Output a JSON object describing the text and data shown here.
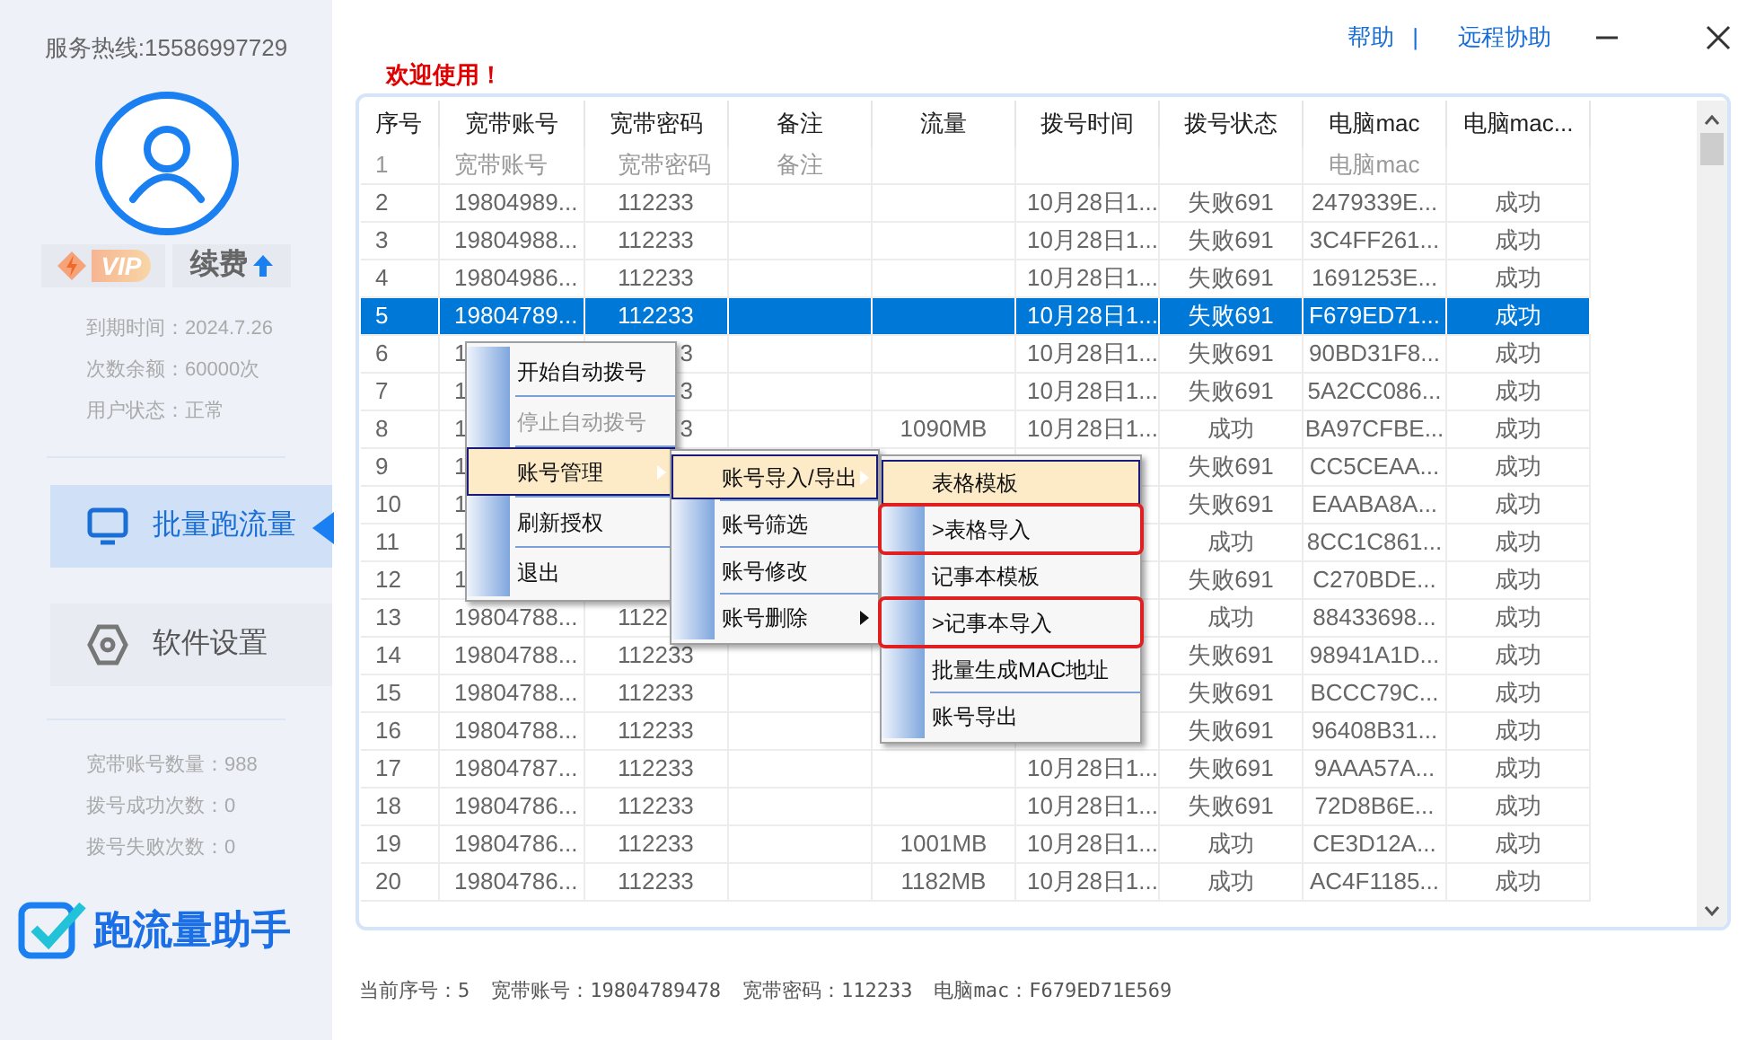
{
  "sidebar": {
    "hotline": "服务热线:15586997729",
    "vip_badge": "VIP",
    "renew_button": "续费",
    "info": [
      "到期时间：2024.7.26",
      "次数余额：60000次",
      "用户状态：正常"
    ],
    "nav": [
      {
        "label": "批量跑流量",
        "selected": true
      },
      {
        "label": "软件设置",
        "selected": false
      }
    ],
    "stats": [
      "宽带账号数量：988",
      "拨号成功次数：0",
      "拨号失败次数：0"
    ],
    "logo": "跑流量助手"
  },
  "header": {
    "links": [
      "帮助",
      "远程协助"
    ],
    "separator": "|",
    "welcome": "欢迎使用！"
  },
  "table": {
    "columns": [
      "序号",
      "宽带账号",
      "宽带密码",
      "备注",
      "流量",
      "拨号时间",
      "拨号状态",
      "电脑mac",
      "电脑mac..."
    ],
    "rows": [
      {
        "kind": "placeholder",
        "selected": false,
        "cells": [
          "1",
          "宽带账号",
          "宽带密码",
          "备注",
          null,
          null,
          null,
          "电脑mac",
          null
        ]
      },
      {
        "kind": "data",
        "selected": false,
        "cells": [
          "2",
          "19804989...",
          "112233",
          null,
          null,
          "10月28日1...",
          "失败691",
          "2479339E...",
          "成功"
        ]
      },
      {
        "kind": "data",
        "selected": false,
        "cells": [
          "3",
          "19804988...",
          "112233",
          null,
          null,
          "10月28日1...",
          "失败691",
          "3C4FF261...",
          "成功"
        ]
      },
      {
        "kind": "data",
        "selected": false,
        "cells": [
          "4",
          "19804986...",
          "112233",
          null,
          null,
          "10月28日1...",
          "失败691",
          "1691253E...",
          "成功"
        ]
      },
      {
        "kind": "data",
        "selected": true,
        "cells": [
          "5",
          "19804789...",
          "112233",
          null,
          null,
          "10月28日1...",
          "失败691",
          "F679ED71...",
          "成功"
        ]
      },
      {
        "kind": "data",
        "selected": false,
        "cells": [
          "6",
          "1",
          {
            "text": "3",
            "clipped_start": true
          },
          null,
          null,
          "10月28日1...",
          "失败691",
          "90BD31F8...",
          "成功"
        ]
      },
      {
        "kind": "data",
        "selected": false,
        "cells": [
          "7",
          "1",
          {
            "text": "3",
            "clipped_start": true
          },
          null,
          null,
          "10月28日1...",
          "失败691",
          "5A2CC086...",
          "成功"
        ]
      },
      {
        "kind": "data",
        "selected": false,
        "cells": [
          "8",
          "1",
          {
            "text": "3",
            "clipped_start": true
          },
          null,
          "1090MB",
          "10月28日1...",
          "成功",
          "BA97CFBE...",
          "成功"
        ]
      },
      {
        "kind": "data",
        "selected": false,
        "cells": [
          "9",
          "1",
          null,
          null,
          null,
          null,
          "失败691",
          "CC5CEAA...",
          "成功"
        ]
      },
      {
        "kind": "data",
        "selected": false,
        "cells": [
          "10",
          "1",
          null,
          null,
          null,
          null,
          "失败691",
          "EAABA8A...",
          "成功"
        ]
      },
      {
        "kind": "data",
        "selected": false,
        "cells": [
          "11",
          "1",
          null,
          null,
          null,
          null,
          "成功",
          "8CC1C861...",
          "成功"
        ]
      },
      {
        "kind": "data",
        "selected": false,
        "cells": [
          "12",
          "1",
          null,
          null,
          null,
          null,
          "失败691",
          "C270BDE...",
          "成功"
        ]
      },
      {
        "kind": "data",
        "selected": false,
        "cells": [
          "13",
          "19804788...",
          "1122",
          null,
          null,
          null,
          "成功",
          "88433698...",
          "成功"
        ]
      },
      {
        "kind": "data",
        "selected": false,
        "cells": [
          "14",
          "19804788...",
          "112233",
          null,
          null,
          null,
          "失败691",
          "98941A1D...",
          "成功"
        ]
      },
      {
        "kind": "data",
        "selected": false,
        "cells": [
          "15",
          "19804788...",
          "112233",
          null,
          null,
          null,
          "失败691",
          "BCCC79C...",
          "成功"
        ]
      },
      {
        "kind": "data",
        "selected": false,
        "cells": [
          "16",
          "19804788...",
          "112233",
          null,
          null,
          null,
          "失败691",
          "96408B31...",
          "成功"
        ]
      },
      {
        "kind": "data",
        "selected": false,
        "cells": [
          "17",
          "19804787...",
          "112233",
          null,
          null,
          "10月28日1...",
          "失败691",
          "9AAA57A...",
          "成功"
        ]
      },
      {
        "kind": "data",
        "selected": false,
        "cells": [
          "18",
          "19804786...",
          "112233",
          null,
          null,
          "10月28日1...",
          "失败691",
          "72D8B6E...",
          "成功"
        ]
      },
      {
        "kind": "data",
        "selected": false,
        "cells": [
          "19",
          "19804786...",
          "112233",
          null,
          "1001MB",
          "10月28日1...",
          "成功",
          "CE3D12A...",
          "成功"
        ]
      },
      {
        "kind": "data",
        "selected": false,
        "cells": [
          "20",
          "19804786...",
          "112233",
          null,
          "1182MB",
          "10月28日1...",
          "成功",
          "AC4F1185...",
          "成功"
        ]
      }
    ]
  },
  "menus": [
    {
      "items": [
        {
          "label": "开始自动拨号",
          "disabled": false,
          "selected": false,
          "submenu": false,
          "marked": false
        },
        {
          "label": "停止自动拨号",
          "disabled": true,
          "selected": false,
          "submenu": false,
          "marked": false
        },
        {
          "label": "账号管理",
          "disabled": false,
          "selected": true,
          "submenu": true,
          "marked": false
        },
        {
          "label": "刷新授权",
          "disabled": false,
          "selected": false,
          "submenu": false,
          "marked": false
        },
        {
          "label": "退出",
          "disabled": false,
          "selected": false,
          "submenu": false,
          "marked": false
        }
      ]
    },
    {
      "items": [
        {
          "label": "账号导入/导出",
          "disabled": false,
          "selected": true,
          "submenu": true,
          "marked": false
        },
        {
          "label": "账号筛选",
          "disabled": false,
          "selected": false,
          "submenu": false,
          "marked": false
        },
        {
          "label": "账号修改",
          "disabled": false,
          "selected": false,
          "submenu": false,
          "marked": false
        },
        {
          "label": "账号删除",
          "disabled": false,
          "selected": false,
          "submenu": true,
          "marked": false
        }
      ]
    },
    {
      "items": [
        {
          "label": "表格模板",
          "disabled": false,
          "selected": true,
          "submenu": false,
          "marked": false
        },
        {
          "label": ">表格导入",
          "disabled": false,
          "selected": false,
          "submenu": false,
          "marked": true
        },
        {
          "label": "记事本模板",
          "disabled": false,
          "selected": false,
          "submenu": false,
          "marked": false
        },
        {
          "label": ">记事本导入",
          "disabled": false,
          "selected": false,
          "submenu": false,
          "marked": true
        },
        {
          "label": "批量生成MAC地址",
          "disabled": false,
          "selected": false,
          "submenu": false,
          "marked": false
        },
        {
          "label": "账号导出",
          "disabled": false,
          "selected": false,
          "submenu": false,
          "marked": false
        }
      ]
    }
  ],
  "status_bar": [
    "当前序号：5",
    "宽带账号：19804789478",
    "宽带密码：112233",
    "电脑mac：F679ED71E569"
  ]
}
